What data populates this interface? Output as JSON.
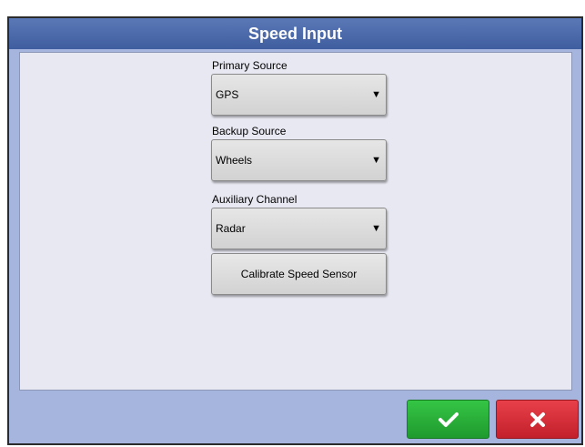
{
  "dialog": {
    "title": "Speed Input"
  },
  "primary_source": {
    "label": "Primary Source",
    "value": "GPS"
  },
  "backup_source": {
    "label": "Backup Source",
    "value": "Wheels"
  },
  "auxiliary_channel": {
    "label": "Auxiliary Channel",
    "value": "Radar"
  },
  "calibrate_button": {
    "label": "Calibrate Speed Sensor"
  },
  "actions": {
    "ok_icon": "checkmark-icon",
    "cancel_icon": "x-icon",
    "ok_color": "#2bb33b",
    "cancel_color": "#d62f39"
  },
  "colors": {
    "titlebar": "#4a68a8",
    "frame": "#a6b5dd",
    "content_bg": "#e8e8f2"
  }
}
